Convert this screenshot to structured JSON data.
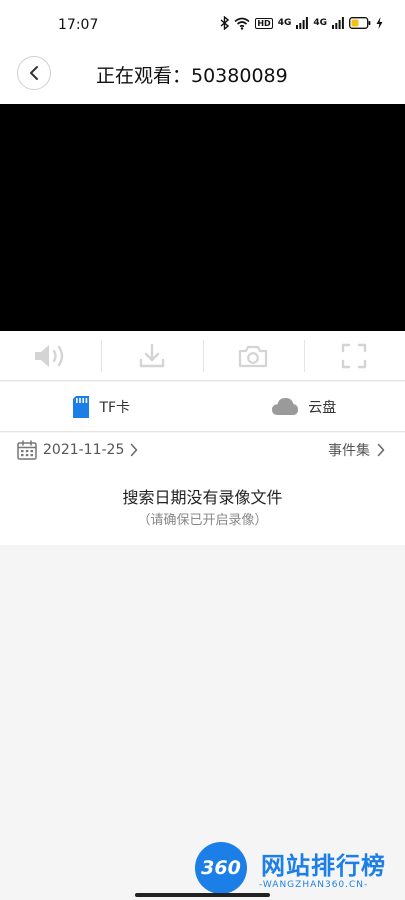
{
  "status_bar": {
    "time": "17:07",
    "icons": [
      "bluetooth-icon",
      "wifi-icon",
      "hd-badge",
      "signal-4g-icon",
      "signal-4g-icon",
      "battery-icon",
      "charging-icon"
    ],
    "hd_label": "HD",
    "network_label": "4G"
  },
  "header": {
    "back_icon": "chevron-left-icon",
    "title": "正在观看：50380089"
  },
  "controls": [
    {
      "icon": "speaker-icon"
    },
    {
      "icon": "download-icon"
    },
    {
      "icon": "camera-icon"
    },
    {
      "icon": "fullscreen-icon"
    }
  ],
  "tabs": [
    {
      "label": "TF卡",
      "icon": "sd-card-icon",
      "color": "#1c7fe8",
      "active": true
    },
    {
      "label": "云盘",
      "icon": "cloud-icon",
      "color": "#9a9a9a",
      "active": false
    }
  ],
  "date_row": {
    "date": "2021-11-25",
    "events_label": "事件集"
  },
  "empty_state": {
    "title": "搜索日期没有录像文件",
    "subtitle": "（请确保已开启录像）"
  },
  "watermark": {
    "logo_text": "360",
    "site_name": "网站排行榜",
    "url": "-WANGZHAN360.CN-",
    "color": "#1c7fe8"
  }
}
